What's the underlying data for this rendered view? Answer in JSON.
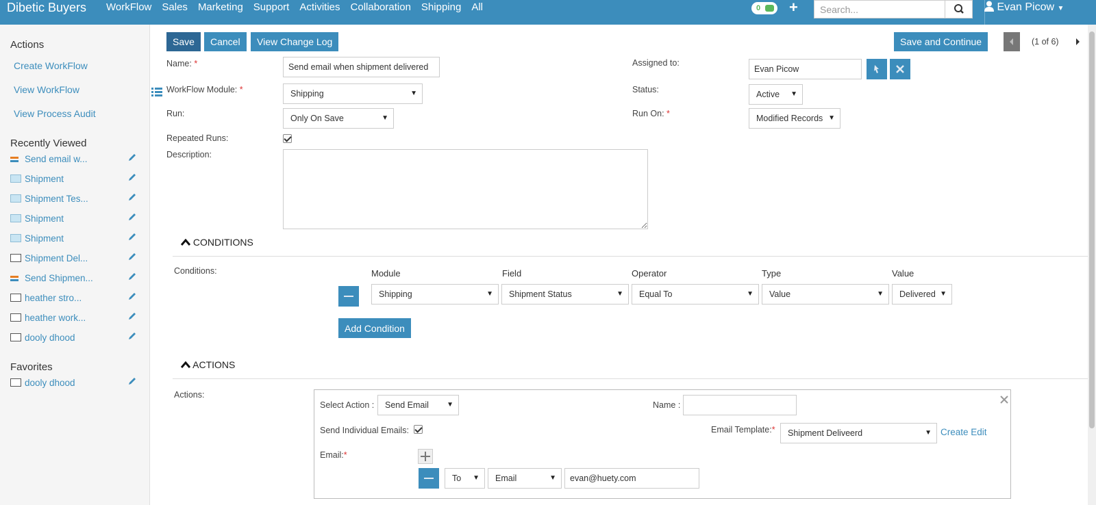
{
  "app": {
    "brand": "Dibetic Buyers",
    "nav": [
      "WorkFlow",
      "Sales",
      "Marketing",
      "Support",
      "Activities",
      "Collaboration",
      "Shipping",
      "All"
    ],
    "notif_count": "0",
    "search_placeholder": "Search...",
    "user": "Evan Picow"
  },
  "sidebar": {
    "actions_heading": "Actions",
    "actions": [
      "Create WorkFlow",
      "View WorkFlow",
      "View Process Audit"
    ],
    "recent_heading": "Recently Viewed",
    "recent": [
      {
        "label": "Send email w...",
        "icon": "workflow-icon"
      },
      {
        "label": "Shipment",
        "icon": "shipment-icon"
      },
      {
        "label": "Shipment Tes...",
        "icon": "shipment-icon"
      },
      {
        "label": "Shipment",
        "icon": "shipment-icon"
      },
      {
        "label": "Shipment",
        "icon": "shipment-icon"
      },
      {
        "label": "Shipment Del...",
        "icon": "email-template-icon"
      },
      {
        "label": "Send Shipmen...",
        "icon": "workflow-icon"
      },
      {
        "label": "heather stro...",
        "icon": "document-icon"
      },
      {
        "label": "heather work...",
        "icon": "document-icon"
      },
      {
        "label": "dooly dhood",
        "icon": "document-icon"
      }
    ],
    "favorites_heading": "Favorites",
    "favorites": [
      {
        "label": "dooly dhood",
        "icon": "document-icon"
      }
    ]
  },
  "toolbar": {
    "save": "Save",
    "cancel": "Cancel",
    "change_log": "View Change Log",
    "save_continue": "Save and Continue",
    "pager": "(1 of 6)"
  },
  "form": {
    "name_label": "Name:",
    "name_value": "Send email when shipment delivered",
    "module_label": "WorkFlow Module:",
    "module_value": "Shipping",
    "run_label": "Run:",
    "run_value": "Only On Save",
    "repeated_label": "Repeated Runs:",
    "repeated_checked": true,
    "description_label": "Description:",
    "description_value": "",
    "assigned_label": "Assigned to:",
    "assigned_value": "Evan Picow",
    "status_label": "Status:",
    "status_value": "Active",
    "runon_label": "Run On:",
    "runon_value": "Modified Records"
  },
  "conditions": {
    "heading": "CONDITIONS",
    "label": "Conditions:",
    "columns": [
      "Module",
      "Field",
      "Operator",
      "Type",
      "Value"
    ],
    "row": [
      "Shipping",
      "Shipment Status",
      "Equal To",
      "Value",
      "Delivered"
    ],
    "add_button": "Add Condition"
  },
  "actions": {
    "heading": "ACTIONS",
    "label": "Actions:",
    "select_action_label": "Select Action :",
    "select_action_value": "Send Email",
    "name_label": "Name :",
    "name_value": "",
    "individual_label": "Send Individual Emails:",
    "individual_checked": true,
    "template_label": "Email Template:",
    "template_value": "Shipment Deliveerd",
    "template_links": "Create Edit",
    "email_label": "Email:",
    "email_to": "To",
    "email_type": "Email",
    "email_value": "evan@huety.com"
  },
  "colors": {
    "primary": "#3c8dbc",
    "dark": "#2d6794"
  }
}
